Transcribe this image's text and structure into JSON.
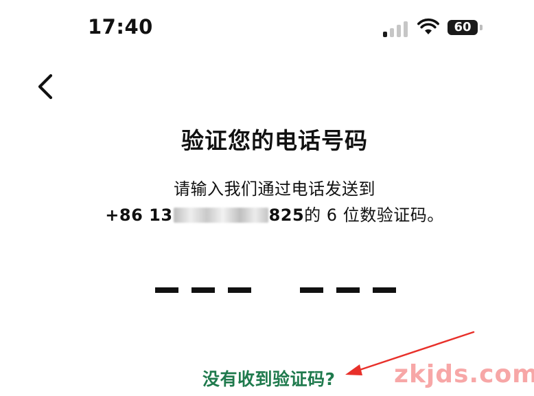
{
  "status_bar": {
    "time": "17:40",
    "battery_level": "60",
    "signal_bars_filled": 1,
    "signal_bars_total": 4,
    "icons": [
      "signal-icon",
      "wifi-icon",
      "battery-icon"
    ]
  },
  "nav": {
    "back_icon": "chevron-left-icon"
  },
  "header": {
    "title": "验证您的电话号码"
  },
  "instructions": {
    "line1": "请输入我们通过电话发送到",
    "phone_prefix": "+86 13",
    "phone_suffix": "825",
    "line2_tail": "的 6 位数验证码。"
  },
  "code_entry": {
    "digits": [
      "",
      "",
      "",
      "",
      "",
      ""
    ]
  },
  "resend": {
    "label": "没有收到验证码?"
  },
  "watermark": {
    "text": "zkjds.com"
  },
  "colors": {
    "link": "#1f7a4d",
    "annotation_arrow": "#e8302a",
    "text": "#111111"
  }
}
